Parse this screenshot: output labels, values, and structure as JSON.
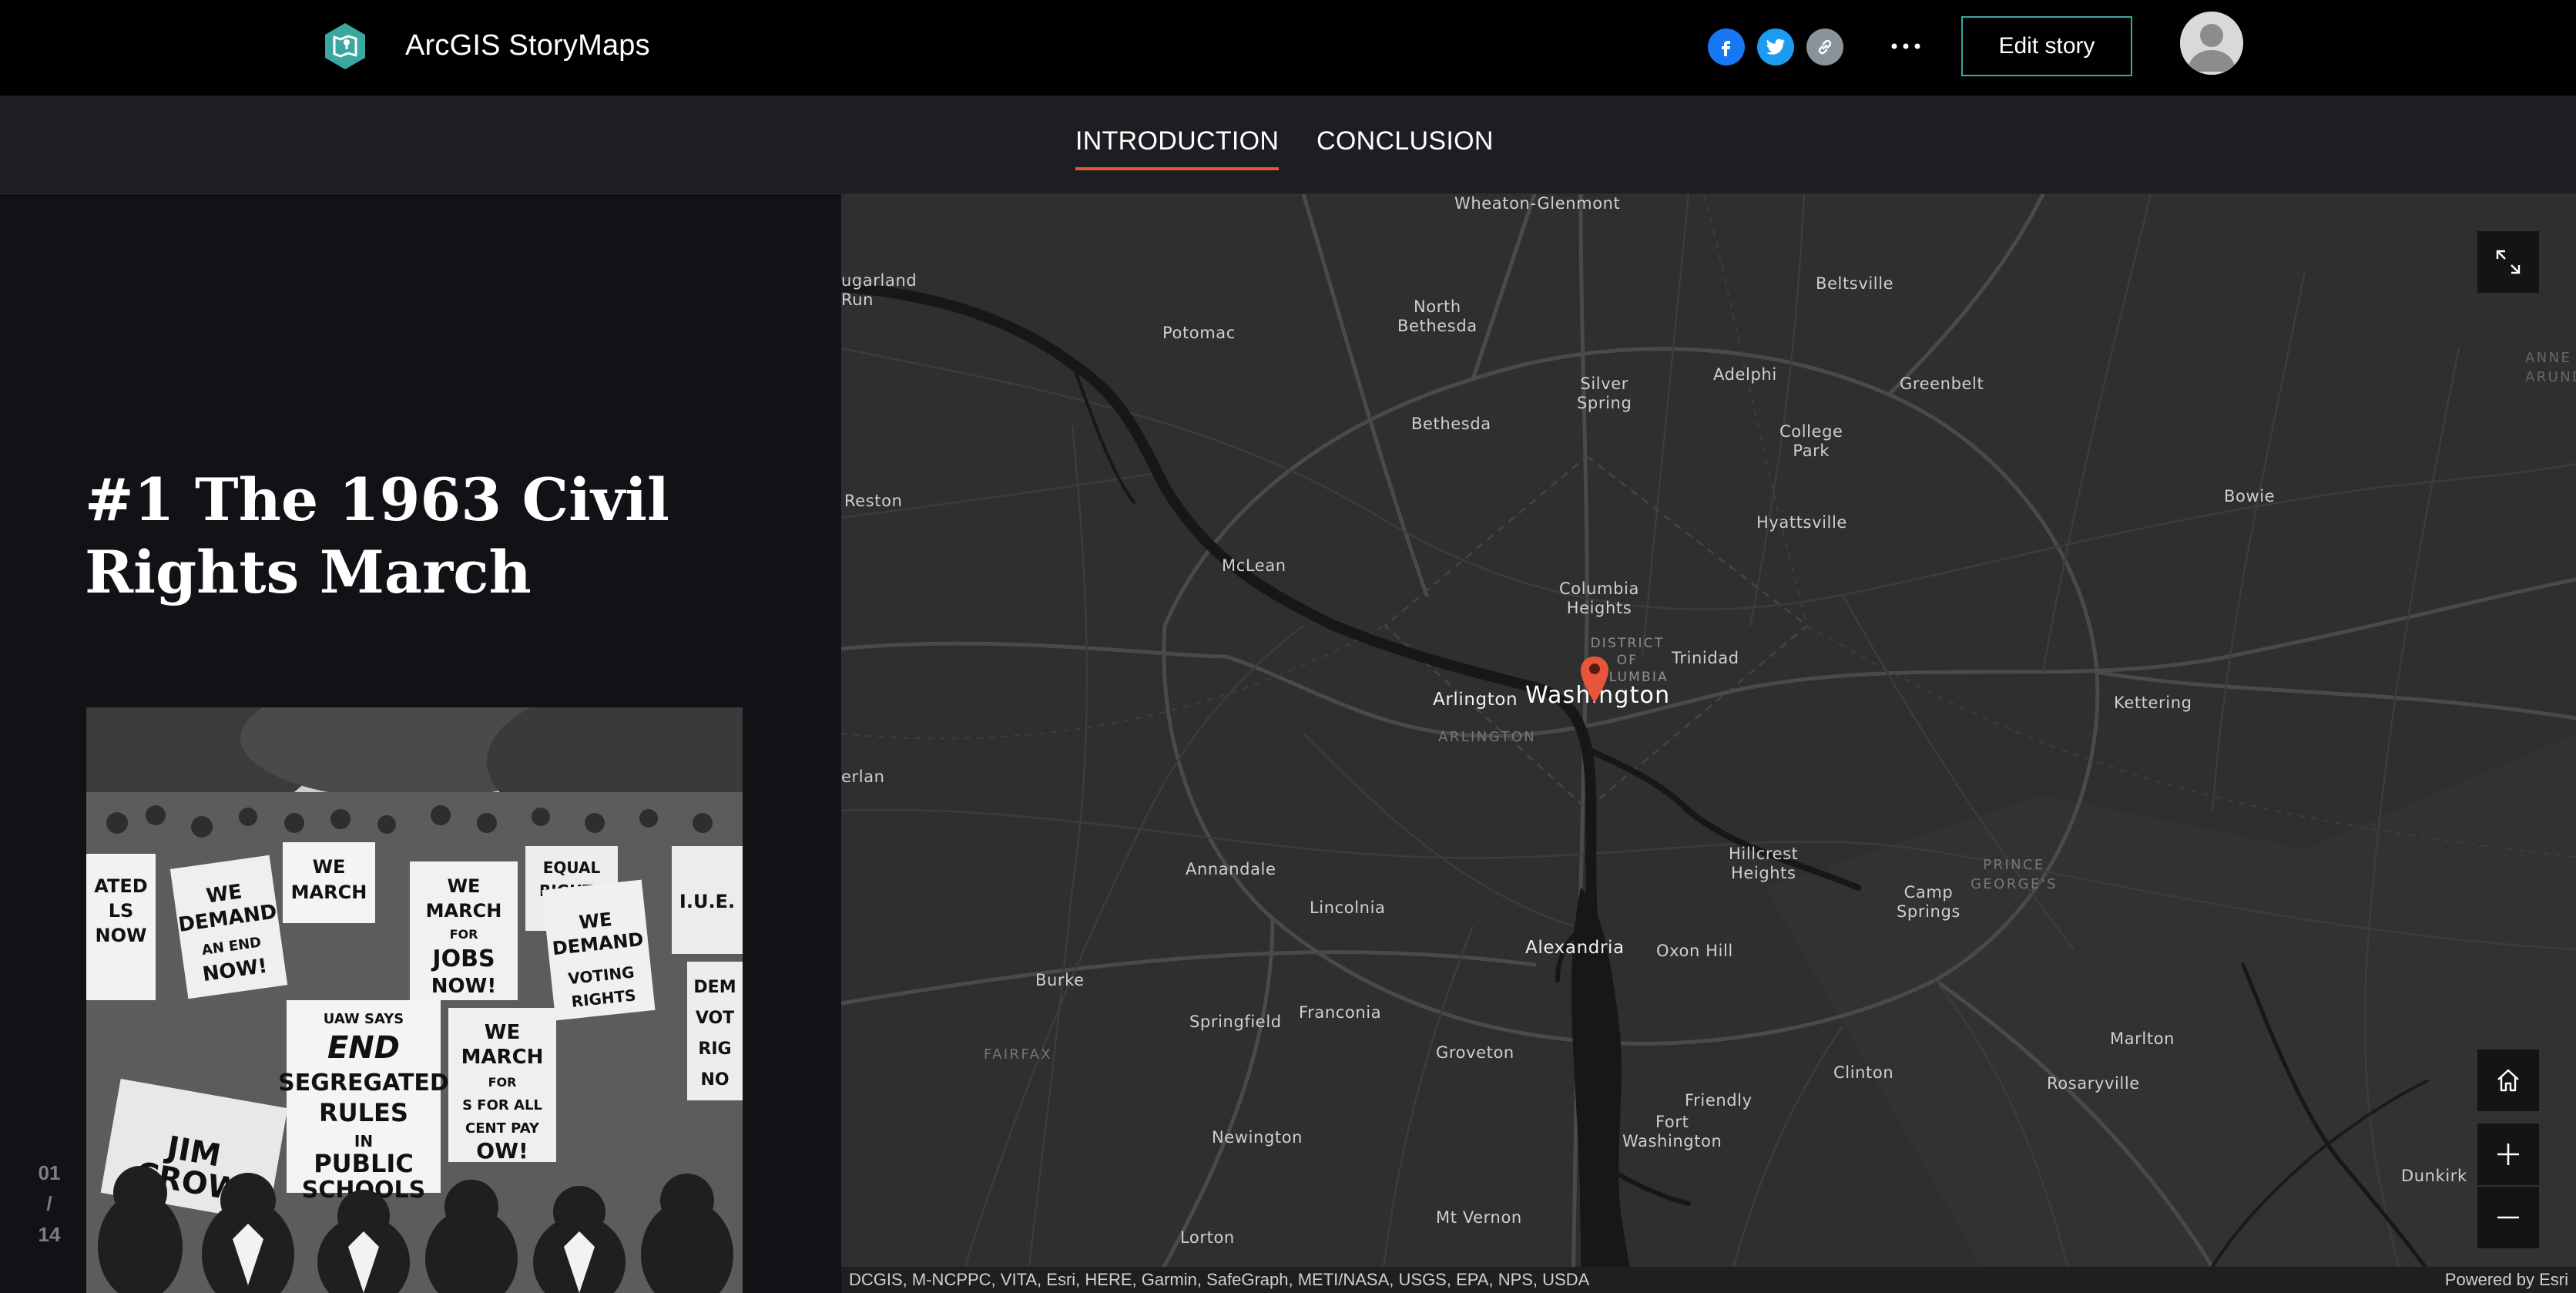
{
  "header": {
    "app_title": "ArcGIS StoryMaps",
    "logo_icon": "storymaps-logo-icon",
    "share": [
      {
        "name": "facebook",
        "icon": "facebook-icon",
        "color": "#1877f2"
      },
      {
        "name": "twitter",
        "icon": "twitter-icon",
        "color": "#1d9bf0"
      },
      {
        "name": "copy-link",
        "icon": "link-icon",
        "color": "#8a9399"
      }
    ],
    "more_icon": "more-horizontal-icon",
    "edit_label": "Edit story",
    "edit_border_color": "#3aa8a0",
    "avatar_icon": "user-avatar-icon"
  },
  "nav": {
    "tabs": [
      {
        "label": "INTRODUCTION",
        "active": true
      },
      {
        "label": "CONCLUSION",
        "active": false
      }
    ],
    "active_color": "#e9553b"
  },
  "story": {
    "title_line1": "#1 The 1963 Civil",
    "title_line2": "Rights March",
    "image": {
      "signs": [
        "WE MARCH",
        "WE DEMAND",
        "JOBS FOR ALL NOW!",
        "EQUAL RIGHTS NOW!",
        "VOTING RIGHTS",
        "UAW SAYS END SEGREGATED RULES IN PUBLIC SCHOOLS",
        "JIM CROW",
        "I.U.E.",
        "WE MARCH FOR"
      ]
    },
    "counter": {
      "current": "01",
      "separator": "/",
      "total": "14"
    }
  },
  "map": {
    "labels": {
      "wheaton": "Wheaton-Glenmont",
      "sugarland_1": "ugarland",
      "sugarland_2": "Run",
      "potomac": "Potomac",
      "north_bethesda_1": "North",
      "north_bethesda_2": "Bethesda",
      "beltsville": "Beltsville",
      "annearundel_1": "ANNE",
      "annearundel_2": "ARUNDE",
      "silver_spring_1": "Silver",
      "silver_spring_2": "Spring",
      "adelphi": "Adelphi",
      "greenbelt": "Greenbelt",
      "bethesda": "Bethesda",
      "college_park_1": "College",
      "college_park_2": "Park",
      "reston": "Reston",
      "bowie": "Bowie",
      "hyattsville": "Hyattsville",
      "mclean": "McLean",
      "columbia_heights_1": "Columbia",
      "columbia_heights_2": "Heights",
      "district_1": "DISTRICT",
      "district_2": "OF",
      "district_3": "COLUMBIA",
      "trinidad": "Trinidad",
      "arlington": "Arlington",
      "washington": "Washington",
      "arlington_county": "ARLINGTON",
      "kettering": "Kettering",
      "herndon": "erlan",
      "annandale": "Annandale",
      "hillcrest_1": "Hillcrest",
      "hillcrest_2": "Heights",
      "princegeorges_1": "PRINCE",
      "princegeorges_2": "GEORGE'S",
      "camp_springs_1": "Camp",
      "camp_springs_2": "Springs",
      "lincolnia": "Lincolnia",
      "alexandria": "Alexandria",
      "oxon_hill": "Oxon Hill",
      "burke": "Burke",
      "springfield": "Springfield",
      "franconia": "Franconia",
      "fairfax": "FAIRFAX",
      "groveton": "Groveton",
      "marlton": "Marlton",
      "clinton": "Clinton",
      "rosaryville": "Rosaryville",
      "friendly": "Friendly",
      "fort_washington_1": "Fort",
      "fort_washington_2": "Washington",
      "newington": "Newington",
      "dunkirk": "Dunkirk",
      "mt_vernon": "Mt Vernon",
      "lorton": "Lorton"
    },
    "controls": {
      "expand_icon": "expand-icon",
      "home_icon": "home-icon",
      "zoom_in_icon": "plus-icon",
      "zoom_out_icon": "minus-icon"
    },
    "pin_icon": "map-pin-icon",
    "pin_color": "#e9553b",
    "attribution": "DCGIS, M-NCPPC, VITA, Esri, HERE, Garmin, SafeGraph, METI/NASA, USGS, EPA, NPS, USDA",
    "powered_by": "Powered by Esri"
  }
}
